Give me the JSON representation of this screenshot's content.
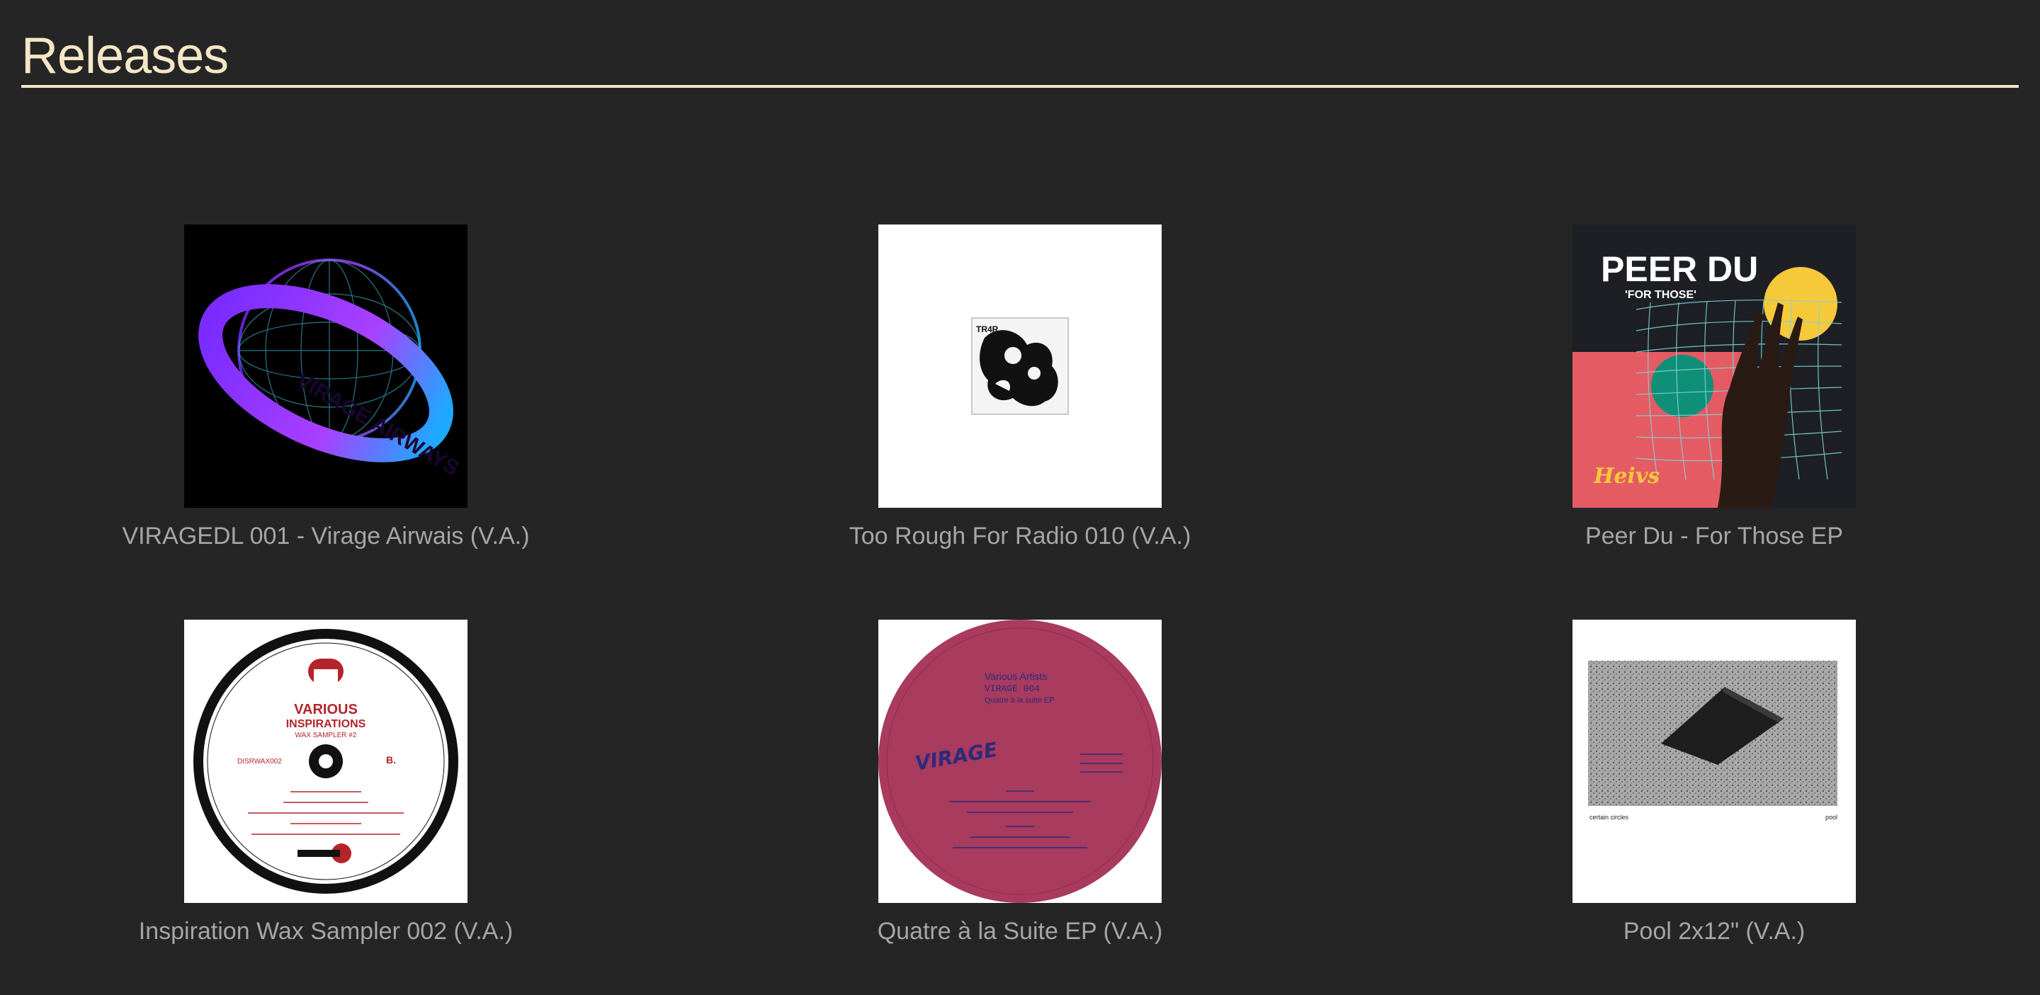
{
  "page": {
    "title": "Releases"
  },
  "colors": {
    "background": "#252525",
    "title": "#f5e6c6",
    "caption": "#a6a6a6"
  },
  "releases": [
    {
      "title": "VIRAGEDL 001 - Virage Airwais (V.A.)",
      "cover_icon": "virage-airways-cover",
      "cover_text": "VIRAGE AIRWAYS"
    },
    {
      "title": "Too Rough For Radio 010 (V.A.)",
      "cover_icon": "too-rough-for-radio-cover",
      "cover_text": "TR4R"
    },
    {
      "title": "Peer Du - For Those EP",
      "cover_icon": "peer-du-cover",
      "cover_text": "PEER DU",
      "cover_subtext": "'FOR THOSE'",
      "cover_logo": "Heivs"
    },
    {
      "title": "Inspiration Wax Sampler 002 (V.A.)",
      "cover_icon": "inspiration-wax-cover",
      "cover_text": "VARIOUS",
      "cover_text2": "INSPIRATIONS",
      "cover_text3": "WAX SAMPLER #2",
      "cover_catalog": "DISRWAX002",
      "cover_side": "B."
    },
    {
      "title": "Quatre à la Suite EP (V.A.)",
      "cover_icon": "quatre-a-la-suite-cover",
      "cover_text": "VIRAGE",
      "cover_line1": "Various Artists",
      "cover_line2": "VIRAGE 004",
      "cover_line3": "Quatre à la suite EP"
    },
    {
      "title": "Pool 2x12\" (V.A.)",
      "cover_icon": "pool-cover",
      "cover_left": "certain circles",
      "cover_right": "pool"
    }
  ]
}
